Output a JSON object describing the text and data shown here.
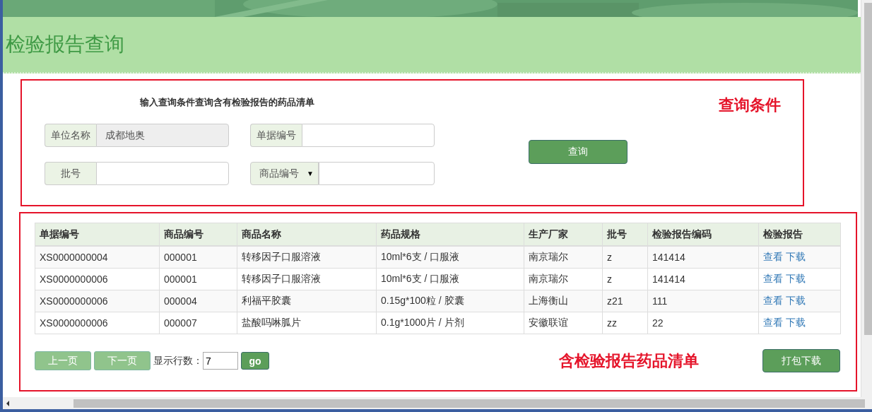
{
  "header": {
    "title": "检验报告查询"
  },
  "query": {
    "heading": "输入查询条件查询含有检验报告的药品清单",
    "annotation": "查询条件",
    "fields": [
      {
        "kind": "text",
        "label": "单位名称",
        "value": "成都地奥",
        "disabled": true
      },
      {
        "kind": "text",
        "label": "单据编号",
        "disabled": false
      },
      {
        "kind": "text",
        "label": "批号",
        "disabled": false
      },
      {
        "kind": "select",
        "label": "商品编号",
        "caret": "▼",
        "disabled": false
      }
    ],
    "button": "查询"
  },
  "results": {
    "columns": [
      "单据编号",
      "商品编号",
      "商品名称",
      "药品规格",
      "生产厂家",
      "批号",
      "检验报告编码",
      "检验报告"
    ],
    "rows": [
      {
        "cells": [
          "XS0000000004",
          "000001",
          "转移因子口服溶液",
          "10ml*6支 / 口服液",
          "南京瑞尔",
          "z",
          "141414"
        ],
        "links": [
          "查看",
          "下载"
        ]
      },
      {
        "cells": [
          "XS0000000006",
          "000001",
          "转移因子口服溶液",
          "10ml*6支 / 口服液",
          "南京瑞尔",
          "z",
          "141414"
        ],
        "links": [
          "查看",
          "下载"
        ]
      },
      {
        "cells": [
          "XS0000000006",
          "000004",
          "利福平胶囊",
          "0.15g*100粒 / 胶囊",
          "上海衡山",
          "z21",
          "111"
        ],
        "links": [
          "查看",
          "下载"
        ]
      },
      {
        "cells": [
          "XS0000000006",
          "000007",
          "盐酸吗啉胍片",
          "0.1g*1000片 / 片剂",
          "安徽联谊",
          "zz",
          "22"
        ],
        "links": [
          "查看",
          "下载"
        ]
      }
    ],
    "pager": {
      "prev": {
        "label": "上一页",
        "disabled": true
      },
      "next": {
        "label": "下一页",
        "disabled": true
      },
      "rows_label": "显示行数：",
      "rows_value": "7",
      "go": "go"
    },
    "annotation": "含检验报告药品清单",
    "download_all": "打包下载"
  }
}
